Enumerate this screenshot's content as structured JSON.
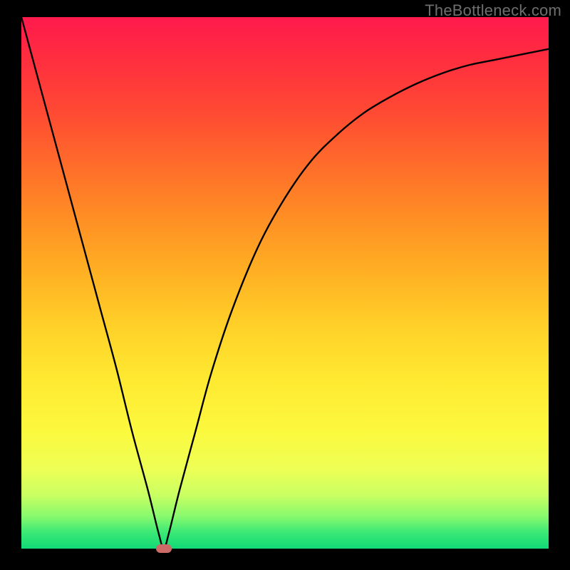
{
  "watermark": "TheBottleneck.com",
  "colors": {
    "curve": "#000000",
    "marker": "#cb6a67",
    "frame": "#000000"
  },
  "chart_data": {
    "type": "line",
    "title": "",
    "xlabel": "",
    "ylabel": "",
    "xlim": [
      0,
      100
    ],
    "ylim": [
      0,
      100
    ],
    "grid": false,
    "legend": false,
    "min_point": {
      "x": 27,
      "y": 0
    },
    "series": [
      {
        "name": "bottleneck-curve",
        "x": [
          0,
          3,
          6,
          9,
          12,
          15,
          18,
          21,
          24,
          26,
          27,
          28,
          30,
          33,
          36,
          40,
          45,
          50,
          55,
          60,
          65,
          70,
          75,
          80,
          85,
          90,
          95,
          100
        ],
        "y": [
          100,
          89,
          78,
          67,
          56,
          45,
          34,
          22,
          11,
          3,
          0,
          3,
          11,
          22,
          33,
          45,
          57,
          66,
          73,
          78,
          82,
          85,
          87.5,
          89.5,
          91,
          92,
          93,
          94
        ]
      }
    ]
  }
}
